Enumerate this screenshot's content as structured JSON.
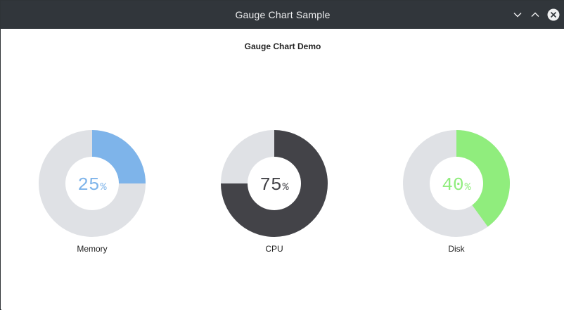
{
  "window": {
    "title": "Gauge Chart Sample"
  },
  "chart_data": {
    "type": "gauge",
    "title": "Gauge Chart Demo",
    "track_color": "#dfe1e5",
    "gauges": [
      {
        "label": "Memory",
        "value": 25,
        "unit": "%",
        "color": "#7eb4ea"
      },
      {
        "label": "CPU",
        "value": 75,
        "unit": "%",
        "color": "#434348"
      },
      {
        "label": "Disk",
        "value": 40,
        "unit": "%",
        "color": "#90ed7d"
      }
    ]
  },
  "icons": {
    "minimize": "chevron-down-icon",
    "maximize": "chevron-up-icon",
    "close": "close-icon"
  }
}
